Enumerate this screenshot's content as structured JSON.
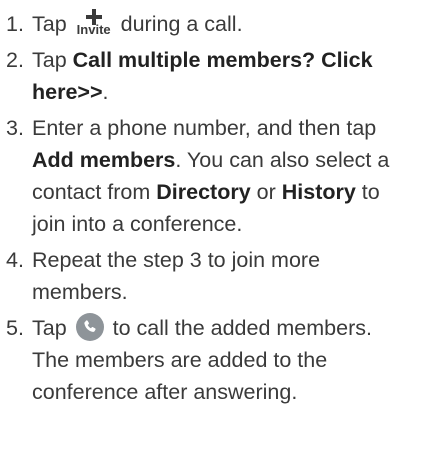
{
  "steps": [
    {
      "num": "1.",
      "pre": "Tap",
      "icon_label": "Invite",
      "post": "during a call."
    },
    {
      "num": "2.",
      "pre": "Tap ",
      "bold": "Call multiple members? Click here>>",
      "post": "."
    },
    {
      "num": "3.",
      "pre": "Enter a phone number, and then tap ",
      "bold1": "Add members",
      "mid1": ". You can also select a contact from ",
      "bold2": "Directory",
      "mid2": " or ",
      "bold3": "History",
      "post": " to join into a conference."
    },
    {
      "num": "4.",
      "text": "Repeat the step 3 to join more members."
    },
    {
      "num": "5.",
      "pre": "Tap",
      "post": "to call the added members. The members are added to the conference after answering."
    }
  ],
  "icons": {
    "invite": "plus-invite-icon",
    "call": "phone-call-icon"
  },
  "colors": {
    "text": "#3a3a3a",
    "call_icon_bg": "#8e9499"
  }
}
